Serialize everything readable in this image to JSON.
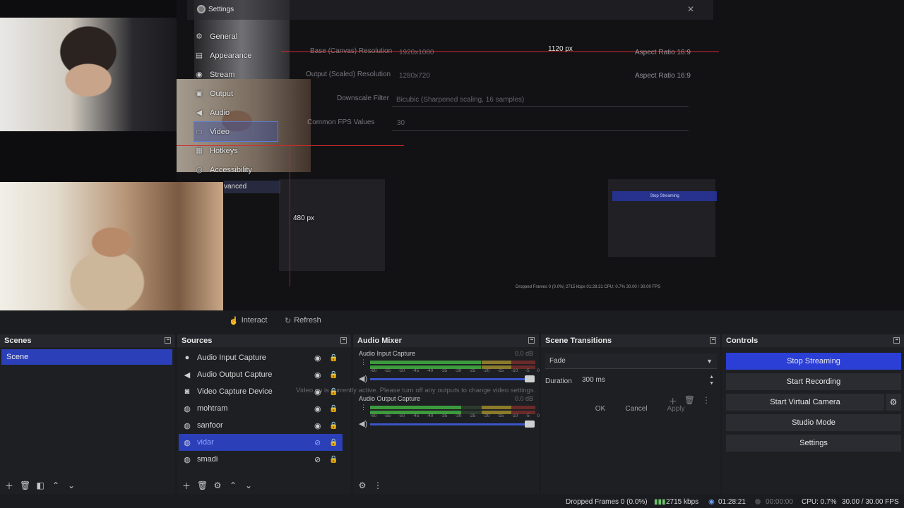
{
  "settings_ghost": {
    "title": "Settings",
    "nav": [
      {
        "label": "General",
        "icon": "gear-icon",
        "glyph": "⚙"
      },
      {
        "label": "Appearance",
        "icon": "palette-icon",
        "glyph": "▤"
      },
      {
        "label": "Stream",
        "icon": "globe-icon",
        "glyph": "◉"
      },
      {
        "label": "Output",
        "icon": "output-icon",
        "glyph": "▣"
      },
      {
        "label": "Audio",
        "icon": "speaker-icon",
        "glyph": "◀"
      },
      {
        "label": "Video",
        "icon": "monitor-icon",
        "glyph": "▭"
      },
      {
        "label": "Hotkeys",
        "icon": "keyboard-icon",
        "glyph": "▦"
      },
      {
        "label": "Accessibility",
        "icon": "accessibility-icon",
        "glyph": "◎"
      }
    ],
    "advanced_fragment": "vanced",
    "base_resolution_label": "Base (Canvas) Resolution",
    "base_resolution_value": "1920x1080",
    "output_resolution_label": "Output (Scaled) Resolution",
    "output_resolution_value": "1280x720",
    "aspect_ratio_1": "Aspect Ratio 16:9",
    "aspect_ratio_2": "Aspect Ratio 16:9",
    "downscale_label": "Downscale Filter",
    "downscale_value": "Bicubic (Sharpened scaling, 16 samples)",
    "fps_label": "Common FPS Values",
    "fps_value": "30",
    "width_measure": "1120 px",
    "height_measure": "480 px"
  },
  "preview_toolbar": {
    "interact": "Interact",
    "refresh": "Refresh"
  },
  "scenes": {
    "title": "Scenes",
    "items": [
      "Scene"
    ]
  },
  "sources": {
    "title": "Sources",
    "items": [
      {
        "label": "Audio Input Capture",
        "icon": "microphone-icon",
        "glyph": "🎙"
      },
      {
        "label": "Audio Output Capture",
        "icon": "speaker-icon",
        "glyph": "🔊"
      },
      {
        "label": "Video Capture Device",
        "icon": "camera-icon",
        "glyph": "◉"
      },
      {
        "label": "mohtram",
        "icon": "globe-icon",
        "glyph": "◍"
      },
      {
        "label": "sanfoor",
        "icon": "globe-icon",
        "glyph": "◍"
      },
      {
        "label": "vidar",
        "icon": "globe-icon",
        "glyph": "◍"
      },
      {
        "label": "smadi",
        "icon": "globe-icon",
        "glyph": "◍"
      }
    ]
  },
  "audio_mixer": {
    "title": "Audio Mixer",
    "channels": [
      {
        "name": "Audio Input Capture",
        "db": "0.0 dB",
        "level": 0.67
      },
      {
        "name": "Audio Output Capture",
        "db": "0.0 dB",
        "level": 0.55
      }
    ],
    "ticks": [
      "-60",
      "-55",
      "-50",
      "-45",
      "-40",
      "-35",
      "-30",
      "-25",
      "-20",
      "-15",
      "-10",
      "-5",
      "0"
    ]
  },
  "overlay_dialog": {
    "message": "Video ou   is currently active. Please turn off any outputs to change video settings.",
    "ok": "OK",
    "cancel": "Cancel",
    "apply": "Apply"
  },
  "scene_transitions": {
    "title": "Scene Transitions",
    "transition": "Fade",
    "duration_label": "Duration",
    "duration_value": "300 ms"
  },
  "controls": {
    "title": "Controls",
    "stop_streaming": "Stop Streaming",
    "start_recording": "Start Recording",
    "start_virtual_camera": "Start Virtual Camera",
    "studio_mode": "Studio Mode",
    "settings": "Settings"
  },
  "status_bar": {
    "dropped_frames": "Dropped Frames 0 (0.0%)",
    "bitrate": "2715 kbps",
    "stream_time": "01:28:21",
    "record_time": "00:00:00",
    "cpu": "CPU: 0.7%",
    "fps": "30.00 / 30.00 FPS"
  },
  "colors": {
    "accent": "#2b3fd6",
    "selection": "#2b3fb8",
    "guide_red": "#d42a2a"
  }
}
